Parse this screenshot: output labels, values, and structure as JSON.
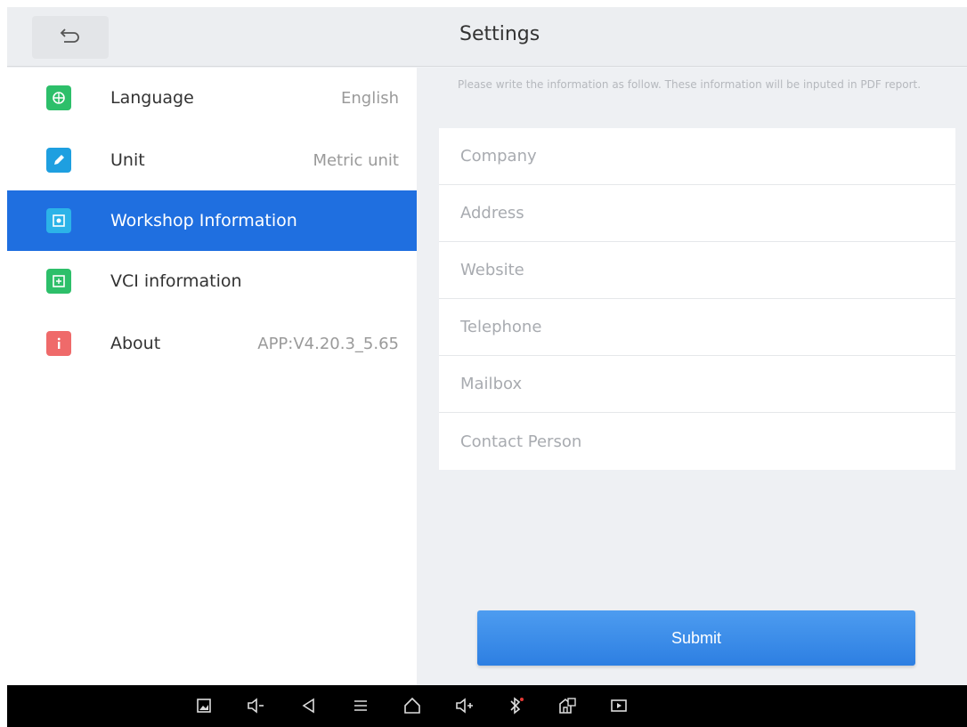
{
  "header": {
    "title": "Settings",
    "back_icon": "back-arrow-icon"
  },
  "sidebar": {
    "items": [
      {
        "label": "Language",
        "value": "English",
        "icon": "globe-icon",
        "color": "#2dbf6a"
      },
      {
        "label": "Unit",
        "value": "Metric unit",
        "icon": "edit-icon",
        "color": "#1e9fe0"
      },
      {
        "label": "Workshop Information",
        "value": "",
        "icon": "workshop-icon",
        "color": "#2cb3e8",
        "active": true
      },
      {
        "label": "VCI information",
        "value": "",
        "icon": "vci-icon",
        "color": "#2dbf6a"
      },
      {
        "label": "About",
        "value": "APP:V4.20.3_5.65",
        "icon": "info-icon",
        "color": "#ef6a6a"
      }
    ]
  },
  "content": {
    "notice": "Please write the information as follow. These information will be inputed in PDF report.",
    "fields": [
      {
        "placeholder": "Company",
        "value": ""
      },
      {
        "placeholder": "Address",
        "value": ""
      },
      {
        "placeholder": "Website",
        "value": ""
      },
      {
        "placeholder": "Telephone",
        "value": ""
      },
      {
        "placeholder": "Mailbox",
        "value": ""
      },
      {
        "placeholder": "Contact Person",
        "value": ""
      }
    ],
    "submit_label": "Submit"
  },
  "navbar": {
    "icons": [
      "screenshot-icon",
      "volume-down-icon",
      "back-icon",
      "menu-icon",
      "home-icon",
      "volume-up-icon",
      "bluetooth-icon",
      "vci-connect-icon",
      "screen-record-icon"
    ]
  },
  "colors": {
    "accent": "#1f6fe0",
    "submit": "#3a8ae8"
  }
}
